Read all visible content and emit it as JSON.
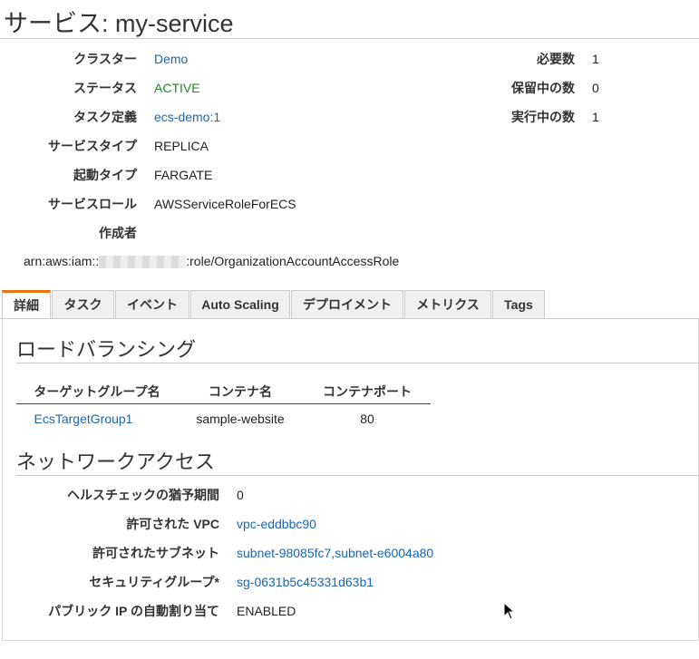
{
  "page": {
    "title": "サービス: my-service"
  },
  "details_left": [
    {
      "label": "クラスター",
      "value": "Demo",
      "style": "link"
    },
    {
      "label": "ステータス",
      "value": "ACTIVE",
      "style": "green"
    },
    {
      "label": "タスク定義",
      "value": "ecs-demo:1",
      "style": "link"
    },
    {
      "label": "サービスタイプ",
      "value": "REPLICA",
      "style": "plain"
    },
    {
      "label": "起動タイプ",
      "value": "FARGATE",
      "style": "plain"
    },
    {
      "label": "サービスロール",
      "value": "AWSServiceRoleForECS",
      "style": "plain"
    },
    {
      "label": "作成者",
      "value": "",
      "style": "plain"
    }
  ],
  "details_right": [
    {
      "label": "必要数",
      "value": "1"
    },
    {
      "label": "保留中の数",
      "value": "0"
    },
    {
      "label": "実行中の数",
      "value": "1"
    }
  ],
  "creator_arn": {
    "prefix": "arn:aws:iam::",
    "suffix": ":role/OrganizationAccountAccessRole"
  },
  "tabs": [
    {
      "label": "詳細",
      "active": true
    },
    {
      "label": "タスク",
      "active": false
    },
    {
      "label": "イベント",
      "active": false
    },
    {
      "label": "Auto Scaling",
      "active": false
    },
    {
      "label": "デプロイメント",
      "active": false
    },
    {
      "label": "メトリクス",
      "active": false
    },
    {
      "label": "Tags",
      "active": false
    }
  ],
  "load_balancing": {
    "title": "ロードバランシング",
    "columns": [
      "ターゲットグループ名",
      "コンテナ名",
      "コンテナポート"
    ],
    "rows": [
      [
        "EcsTargetGroup1",
        "sample-website",
        "80"
      ]
    ]
  },
  "network": {
    "title": "ネットワークアクセス",
    "items": [
      {
        "label": "ヘルスチェックの猶予期間",
        "value": "0",
        "style": "plain"
      },
      {
        "label": "許可された VPC",
        "value": "vpc-eddbbc90",
        "style": "link"
      },
      {
        "label": "許可されたサブネット",
        "value": "subnet-98085fc7,subnet-e6004a80",
        "style": "link"
      },
      {
        "label": "セキュリティグループ*",
        "value": "sg-0631b5c45331d63b1",
        "style": "link"
      },
      {
        "label": "パブリック IP の自動割り当て",
        "value": "ENABLED",
        "style": "plain"
      }
    ]
  },
  "colors": {
    "link": "#1a66b0",
    "active": "#1d8a21",
    "tab_accent": "#ec7211"
  }
}
